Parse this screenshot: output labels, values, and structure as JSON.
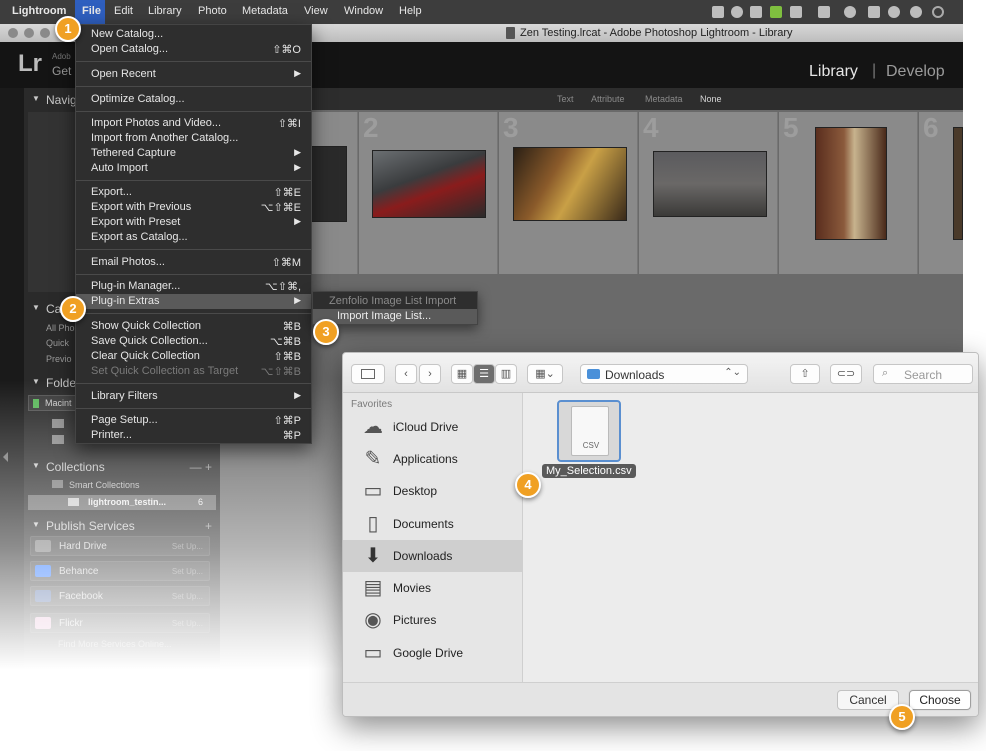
{
  "menubar": {
    "app": "Lightroom",
    "items": [
      "File",
      "Edit",
      "Library",
      "Photo",
      "Metadata",
      "View",
      "Window",
      "Help"
    ]
  },
  "window": {
    "title": "Zen Testing.lrcat - Adobe Photoshop Lightroom - Library",
    "logo": "Lr",
    "adobe_label": "Adob",
    "get_label": "Get",
    "modules": {
      "library": "Library",
      "separator": "|",
      "develop": "Develop"
    }
  },
  "left_panel": {
    "navigator": "Navig",
    "catalog": "Ca",
    "catalog_items": [
      "All Pho",
      "Quick",
      "Previo"
    ],
    "folders": "Folde",
    "folder_drive": "Macint",
    "collections": "Collections",
    "collections_actions": "— +",
    "smart_collections": "Smart Collections",
    "collection_item": "lightroom_testin...",
    "collection_count": "6",
    "publish_services": "Publish Services",
    "publish_add": "+",
    "publish_rows": [
      {
        "name": "Hard Drive",
        "setup": "Set Up..."
      },
      {
        "name": "Behance",
        "setup": "Set Up..."
      },
      {
        "name": "Facebook",
        "setup": "Set Up..."
      },
      {
        "name": "Flickr",
        "setup": "Set Up..."
      }
    ],
    "find_more": "Find More Services Online..."
  },
  "filter_bar": [
    "Text",
    "Attribute",
    "Metadata",
    "None"
  ],
  "grid": {
    "cell_numbers": [
      "1",
      "2",
      "3",
      "4",
      "5",
      "6"
    ]
  },
  "file_menu": {
    "items": [
      {
        "label": "New Catalog...",
        "shortcut": ""
      },
      {
        "label": "Open Catalog...",
        "shortcut": "⇧⌘O"
      },
      {
        "label": "Open Recent",
        "shortcut": "▶"
      },
      {
        "label": "Optimize Catalog...",
        "shortcut": ""
      },
      {
        "label": "Import Photos and Video...",
        "shortcut": "⇧⌘I"
      },
      {
        "label": "Import from Another Catalog...",
        "shortcut": ""
      },
      {
        "label": "Tethered Capture",
        "shortcut": "▶"
      },
      {
        "label": "Auto Import",
        "shortcut": "▶"
      },
      {
        "label": "Export...",
        "shortcut": "⇧⌘E"
      },
      {
        "label": "Export with Previous",
        "shortcut": "⌥⇧⌘E"
      },
      {
        "label": "Export with Preset",
        "shortcut": "▶"
      },
      {
        "label": "Export as Catalog...",
        "shortcut": ""
      },
      {
        "label": "Email Photos...",
        "shortcut": "⇧⌘M"
      },
      {
        "label": "Plug-in Manager...",
        "shortcut": "⌥⇧⌘,"
      },
      {
        "label": "Plug-in Extras",
        "shortcut": "▶"
      },
      {
        "label": "Show Quick Collection",
        "shortcut": "⌘B"
      },
      {
        "label": "Save Quick Collection...",
        "shortcut": "⌥⌘B"
      },
      {
        "label": "Clear Quick Collection",
        "shortcut": "⇧⌘B"
      },
      {
        "label": "Set Quick Collection as Target",
        "shortcut": "⌥⇧⌘B"
      },
      {
        "label": "Library Filters",
        "shortcut": "▶"
      },
      {
        "label": "Page Setup...",
        "shortcut": "⇧⌘P"
      },
      {
        "label": "Printer...",
        "shortcut": "⌘P"
      }
    ]
  },
  "submenu": {
    "item1": "Zenfolio Image List Import",
    "item2": "Import Image List..."
  },
  "badges": [
    "1",
    "2",
    "3",
    "4",
    "5"
  ],
  "dialog": {
    "location": "Downloads",
    "location_arrows": "⌃⌄",
    "search_placeholder": "Search",
    "favorites_header": "Favorites",
    "sidebar": [
      "iCloud Drive",
      "Applications",
      "Desktop",
      "Documents",
      "Downloads",
      "Movies",
      "Pictures",
      "Google Drive"
    ],
    "file": {
      "ext": "CSV",
      "name": "My_Selection.csv"
    },
    "cancel": "Cancel",
    "choose": "Choose"
  }
}
